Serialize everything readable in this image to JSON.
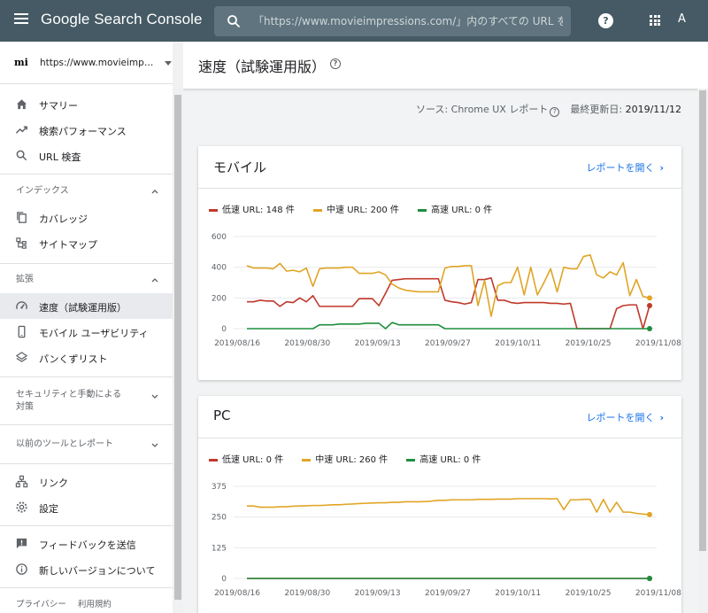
{
  "app": {
    "brand": "Google Search Console",
    "search_placeholder": "「https://www.movieimpressions.com/」内のすべての URL を",
    "avatar_letter": "A",
    "help_label": "?"
  },
  "sidebar": {
    "property_logo": "mi",
    "property_name": "https://www.movieimpressions.com/",
    "items_top": [
      {
        "label": "サマリー",
        "icon": "home-icon"
      },
      {
        "label": "検索パフォーマンス",
        "icon": "trending-up-icon"
      },
      {
        "label": "URL 検査",
        "icon": "search-icon"
      }
    ],
    "section_index": "インデックス",
    "items_index": [
      {
        "label": "カバレッジ",
        "icon": "copy-icon"
      },
      {
        "label": "サイトマップ",
        "icon": "sitemap-icon"
      }
    ],
    "section_enhance": "拡張",
    "items_enhance": [
      {
        "label": "速度（試験運用版）",
        "icon": "speed-icon",
        "active": true
      },
      {
        "label": "モバイル ユーザビリティ",
        "icon": "smartphone-icon"
      },
      {
        "label": "パンくずリスト",
        "icon": "layers-icon"
      }
    ],
    "section_security": "セキュリティと手動による\n対策",
    "section_security_line1": "セキュリティと手動による",
    "section_security_line2": "対策",
    "section_legacy": "以前のツールとレポート",
    "items_links": [
      {
        "label": "リンク",
        "icon": "links-icon"
      },
      {
        "label": "設定",
        "icon": "settings-icon"
      }
    ],
    "items_bottom": [
      {
        "label": "フィードバックを送信",
        "icon": "feedback-icon"
      },
      {
        "label": "新しいバージョンについて",
        "icon": "info-icon"
      }
    ],
    "footer": [
      "プライバシー",
      "利用規約"
    ]
  },
  "page": {
    "title": "速度（試験運用版）",
    "source_label": "ソース: Chrome UX レポート",
    "updated_label": "最終更新日:",
    "updated_value": "2019/11/12"
  },
  "colors": {
    "slow": "#c0392b",
    "medium": "#e0a526",
    "fast": "#1e8e3e",
    "link": "#1a73e8"
  },
  "cards": [
    {
      "title": "モバイル",
      "link": "レポートを開く",
      "legend": [
        "低速 URL: 148 件",
        "中速 URL: 200 件",
        "高速 URL: 0 件"
      ],
      "chart_data": {
        "type": "line",
        "x_ticks": [
          "2019/08/16",
          "2019/08/30",
          "2019/09/13",
          "2019/09/27",
          "2019/10/11",
          "2019/10/25",
          "2019/11/08"
        ],
        "y_ticks": [
          0,
          200,
          400,
          600
        ],
        "ylim": [
          0,
          600
        ],
        "series": [
          {
            "name": "低速 URL",
            "color": "slow",
            "values": [
              175,
              175,
              185,
              180,
              180,
              145,
              175,
              170,
              200,
              175,
              215,
              145,
              145,
              145,
              145,
              145,
              145,
              195,
              195,
              195,
              150,
              230,
              315,
              320,
              325,
              325,
              325,
              325,
              325,
              325,
              185,
              175,
              170,
              160,
              170,
              320,
              320,
              330,
              185,
              185,
              170,
              165,
              170,
              170,
              170,
              170,
              165,
              165,
              160,
              165,
              0,
              0,
              0,
              0,
              0,
              0,
              130,
              150,
              155,
              155,
              0,
              150
            ]
          },
          {
            "name": "中速 URL",
            "color": "medium",
            "values": [
              410,
              395,
              395,
              395,
              390,
              425,
              375,
              380,
              370,
              395,
              275,
              390,
              395,
              395,
              395,
              400,
              400,
              360,
              360,
              360,
              370,
              350,
              290,
              265,
              250,
              245,
              240,
              240,
              240,
              240,
              395,
              405,
              405,
              410,
              410,
              150,
              315,
              80,
              280,
              300,
              300,
              400,
              220,
              400,
              220,
              300,
              390,
              240,
              400,
              390,
              390,
              470,
              480,
              350,
              330,
              370,
              350,
              430,
              215,
              320,
              210,
              200
            ]
          },
          {
            "name": "高速 URL",
            "color": "fast",
            "values": [
              0,
              0,
              0,
              0,
              0,
              0,
              0,
              0,
              0,
              0,
              0,
              25,
              25,
              25,
              30,
              30,
              30,
              30,
              35,
              35,
              35,
              0,
              40,
              25,
              25,
              25,
              25,
              25,
              25,
              25,
              0,
              0,
              0,
              0,
              0,
              0,
              0,
              0,
              0,
              0,
              0,
              0,
              0,
              0,
              0,
              0,
              0,
              0,
              0,
              0,
              0,
              0,
              0,
              0,
              0,
              0,
              0,
              0,
              0,
              0,
              0,
              0
            ]
          }
        ]
      }
    },
    {
      "title": "PC",
      "link": "レポートを開く",
      "legend": [
        "低速 URL: 0 件",
        "中速 URL: 260 件",
        "高速 URL: 0 件"
      ],
      "chart_data": {
        "type": "line",
        "x_ticks": [
          "2019/08/16",
          "2019/08/30",
          "2019/09/13",
          "2019/09/27",
          "2019/10/11",
          "2019/10/25",
          "2019/11/08"
        ],
        "y_ticks": [
          0,
          125,
          250,
          375
        ],
        "ylim": [
          0,
          375
        ],
        "series": [
          {
            "name": "低速 URL",
            "color": "slow",
            "values": [
              0,
              0,
              0,
              0,
              0,
              0,
              0,
              0,
              0,
              0,
              0,
              0,
              0,
              0,
              0,
              0,
              0,
              0,
              0,
              0,
              0,
              0,
              0,
              0,
              0,
              0,
              0,
              0,
              0,
              0,
              0,
              0,
              0,
              0,
              0,
              0,
              0,
              0,
              0,
              0,
              0,
              0,
              0,
              0,
              0,
              0,
              0,
              0,
              0,
              0,
              0,
              0,
              0,
              0,
              0,
              0,
              0,
              0,
              0,
              0,
              0,
              0
            ]
          },
          {
            "name": "中速 URL",
            "color": "medium",
            "values": [
              295,
              295,
              290,
              290,
              290,
              292,
              292,
              294,
              295,
              296,
              297,
              297,
              298,
              300,
              300,
              302,
              303,
              305,
              306,
              307,
              308,
              308,
              310,
              310,
              312,
              312,
              312,
              313,
              315,
              318,
              318,
              320,
              320,
              320,
              320,
              322,
              322,
              322,
              323,
              323,
              323,
              325,
              325,
              325,
              325,
              325,
              324,
              325,
              280,
              320,
              320,
              322,
              322,
              270,
              322,
              270,
              310,
              270,
              270,
              265,
              262,
              260
            ]
          },
          {
            "name": "高速 URL",
            "color": "fast",
            "values": [
              0,
              0,
              0,
              0,
              0,
              0,
              0,
              0,
              0,
              0,
              0,
              0,
              0,
              0,
              0,
              0,
              0,
              0,
              0,
              0,
              0,
              0,
              0,
              0,
              0,
              0,
              0,
              0,
              0,
              0,
              0,
              0,
              0,
              0,
              0,
              0,
              0,
              0,
              0,
              0,
              0,
              0,
              0,
              0,
              0,
              0,
              0,
              0,
              0,
              0,
              0,
              0,
              0,
              0,
              0,
              0,
              0,
              0,
              0,
              0,
              0,
              0
            ]
          }
        ]
      }
    }
  ]
}
